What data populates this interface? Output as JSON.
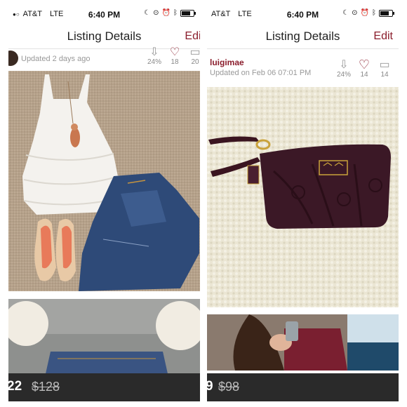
{
  "left": {
    "status": {
      "carrier": "AT&T",
      "network": "LTE",
      "time": "6:40 PM"
    },
    "nav": {
      "title": "Listing Details",
      "edit": "Edit"
    },
    "listing": {
      "updated": "Updated 2 days ago",
      "stats": {
        "share_pct": "24%",
        "likes": "18",
        "comments": "20"
      }
    },
    "price": {
      "current": "22",
      "original": "$128"
    }
  },
  "right": {
    "status": {
      "carrier": "AT&T",
      "network": "LTE",
      "time": "6:40 PM"
    },
    "nav": {
      "title": "Listing Details",
      "edit": "Edit"
    },
    "listing": {
      "username": "luigimae",
      "updated": "Updated on Feb 06 07:01 PM",
      "stats": {
        "share_pct": "24%",
        "likes": "14",
        "comments": "14"
      }
    },
    "price": {
      "current": "9",
      "original": "$98"
    }
  },
  "colors": {
    "accent": "#8b1e2d",
    "price_bar": "#2a2a2a"
  },
  "icons": [
    "share-down-icon",
    "heart-icon",
    "comment-icon",
    "battery-icon",
    "alarm-icon",
    "bluetooth-icon",
    "moon-icon"
  ]
}
